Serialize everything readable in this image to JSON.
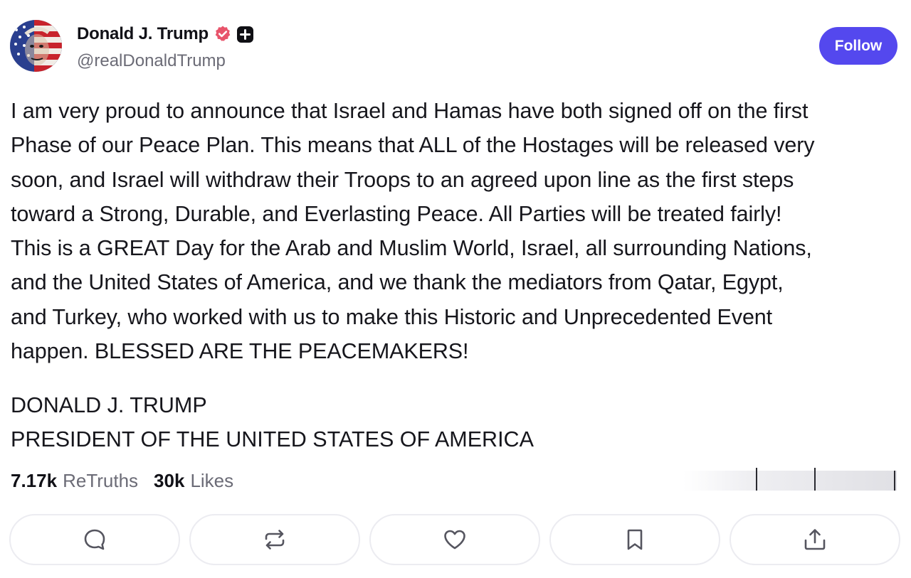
{
  "author": {
    "display_name": "Donald J. Trump",
    "handle": "@realDonaldTrump",
    "verified_icon": "verified-badge-icon",
    "plus_icon": "plus-badge-icon",
    "avatar": "flag-face-avatar"
  },
  "follow_button": {
    "label": "Follow",
    "color": "#5448ee"
  },
  "post": {
    "lines": [
      "I am very proud to announce that Israel and Hamas have both signed off on the first",
      "Phase of our Peace Plan. This means that ALL of the Hostages will be released very",
      "soon, and Israel will withdraw their Troops to an agreed upon line as the first steps",
      "toward a Strong, Durable, and Everlasting Peace. All Parties will be treated fairly!",
      "This is a GREAT Day for the Arab and Muslim World, Israel, all surrounding Nations,",
      "and the United States of America, and we thank the mediators from Qatar, Egypt,",
      "and Turkey, who worked with us to make this Historic and Unprecedented Event",
      "happen. BLESSED ARE THE PEACEMAKERS!"
    ],
    "signature_name": "DONALD J. TRUMP",
    "signature_title": "PRESIDENT OF THE UNITED STATES OF AMERICA"
  },
  "stats": {
    "retruths_count": "7.17k",
    "retruths_label": "ReTruths",
    "likes_count": "30k",
    "likes_label": "Likes"
  },
  "actions": [
    {
      "name": "reply",
      "icon": "comment-icon"
    },
    {
      "name": "retruth",
      "icon": "repost-icon"
    },
    {
      "name": "like",
      "icon": "heart-icon"
    },
    {
      "name": "bookmark",
      "icon": "bookmark-icon"
    },
    {
      "name": "share",
      "icon": "share-icon"
    }
  ],
  "colors": {
    "verified": "#e8546b",
    "accent": "#5448ee",
    "muted_text": "#6b6b76"
  }
}
